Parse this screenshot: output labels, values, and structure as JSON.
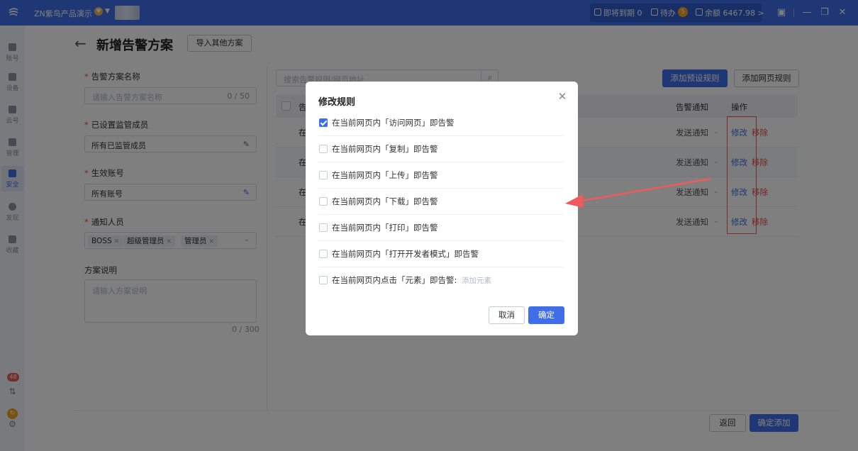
{
  "topbar": {
    "app_title": "ZN紫鸟产品演示",
    "expiring_label": "即将到期",
    "expiring_count": "0",
    "todo_label": "待办",
    "todo_count": "5",
    "balance_label": "余额",
    "balance_value": "6467.98",
    "balance_chevron": ">"
  },
  "rail": {
    "items": [
      {
        "label": "账号"
      },
      {
        "label": "设备"
      },
      {
        "label": "云号"
      },
      {
        "label": "管理"
      },
      {
        "label": "安全"
      },
      {
        "label": "发现"
      },
      {
        "label": "收藏"
      }
    ],
    "message_badge": "48"
  },
  "page": {
    "title": "新增告警方案",
    "import_button": "导入其他方案"
  },
  "form": {
    "scheme_name": {
      "label": "告警方案名称",
      "placeholder": "请输入告警方案名称",
      "count": "0 / 50"
    },
    "members": {
      "label": "已设置监管成员",
      "value": "所有已监管成员"
    },
    "accounts": {
      "label": "生效账号",
      "value": "所有账号"
    },
    "notify": {
      "label": "通知人员",
      "tags": [
        "BOSS",
        "超级管理员",
        "管理员"
      ]
    },
    "description": {
      "label": "方案说明",
      "placeholder": "请输入方案说明",
      "count": "0 / 300"
    }
  },
  "rules_panel": {
    "search_placeholder": "搜索告警规则/网页地址",
    "add_preset_button": "添加预设规则",
    "add_web_button": "添加网页规则",
    "columns": {
      "rule": "告",
      "notify": "告警通知",
      "ops": "操作"
    },
    "rows": [
      {
        "rule": "在",
        "notify": "发送通知",
        "edit": "修改",
        "remove": "移除"
      },
      {
        "rule": "在",
        "notify": "发送通知",
        "edit": "修改",
        "remove": "移除"
      },
      {
        "rule": "在",
        "notify": "发送通知",
        "edit": "修改",
        "remove": "移除"
      },
      {
        "rule": "在",
        "notify": "发送通知",
        "edit": "修改",
        "remove": "移除"
      }
    ]
  },
  "footer": {
    "back_button": "返回",
    "confirm_button": "确定添加"
  },
  "modal": {
    "title": "修改规则",
    "rules": [
      {
        "text": "在当前网页内「访问网页」即告警",
        "checked": true
      },
      {
        "text": "在当前网页内「复制」即告警",
        "checked": false
      },
      {
        "text": "在当前网页内「上传」即告警",
        "checked": false
      },
      {
        "text": "在当前网页内「下载」即告警",
        "checked": false
      },
      {
        "text": "在当前网页内「打印」即告警",
        "checked": false
      },
      {
        "text": "在当前网页内「打开开发者模式」即告警",
        "checked": false
      },
      {
        "text": "在当前网页内点击「元素」即告警:",
        "checked": false,
        "extra": "添加元素"
      }
    ],
    "cancel_button": "取消",
    "ok_button": "确定"
  },
  "colors": {
    "primary": "#3f6ee8",
    "danger": "#e24a4a",
    "annotation": "#f05a5a"
  }
}
